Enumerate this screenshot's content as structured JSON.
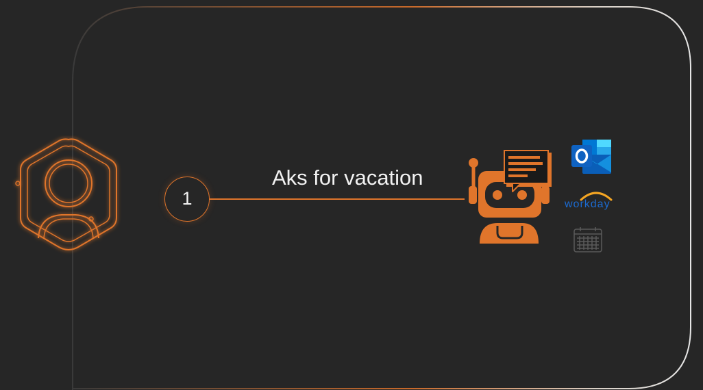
{
  "step": {
    "number": "1",
    "label": "Aks for vacation"
  },
  "actors": {
    "user_icon": "user-hexagon-icon",
    "bot_icon": "chatbot-icon"
  },
  "integrations": [
    {
      "name": "outlook",
      "icon": "outlook-icon"
    },
    {
      "name": "workday",
      "icon": "workday-logo",
      "wordmark": "workday"
    },
    {
      "name": "calendar",
      "icon": "calendar-icon"
    }
  ],
  "colors": {
    "background": "#262626",
    "accent": "#e0752b",
    "text": "#f2f2f2",
    "workday_blue": "#1c6bd1",
    "workday_arc": "#f5a623"
  }
}
